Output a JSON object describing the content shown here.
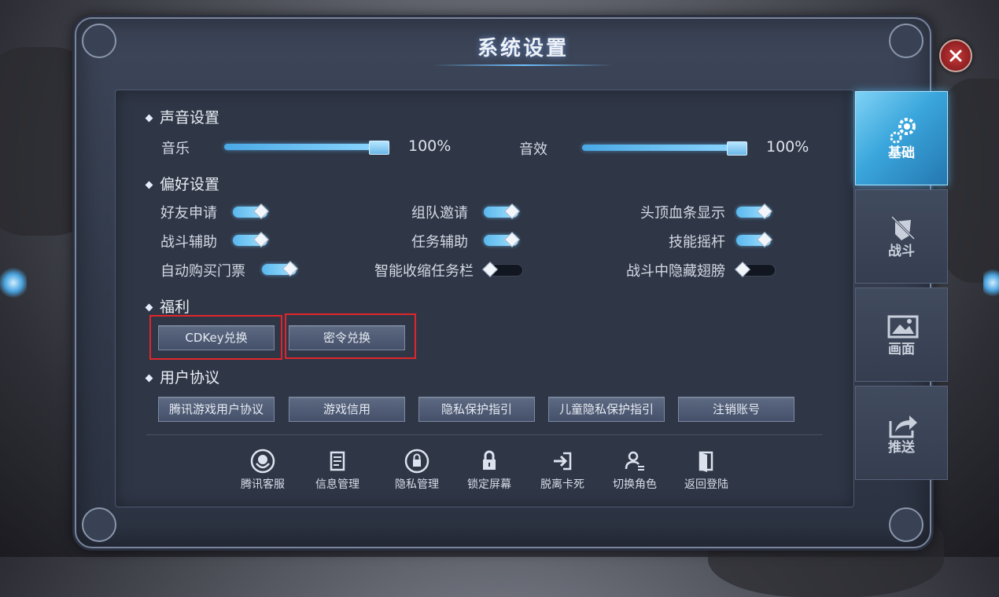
{
  "dialog": {
    "title": "系统设置"
  },
  "sound": {
    "section_title": "声音设置",
    "music_label": "音乐",
    "music_value": "100%",
    "effects_label": "音效",
    "effects_value": "100%"
  },
  "preferences": {
    "section_title": "偏好设置",
    "items": [
      {
        "label": "好友申请",
        "on": true
      },
      {
        "label": "组队邀请",
        "on": true
      },
      {
        "label": "头顶血条显示",
        "on": true
      },
      {
        "label": "战斗辅助",
        "on": true
      },
      {
        "label": "任务辅助",
        "on": true
      },
      {
        "label": "技能摇杆",
        "on": true
      },
      {
        "label": "自动购买门票",
        "on": true
      },
      {
        "label": "智能收缩任务栏",
        "on": false
      },
      {
        "label": "战斗中隐藏翅膀",
        "on": false
      }
    ]
  },
  "welfare": {
    "section_title": "福利",
    "cdkey_button": "CDKey兑换",
    "password_button": "密令兑换"
  },
  "agreement": {
    "section_title": "用户协议",
    "buttons": [
      "腾讯游戏用户协议",
      "游戏信用",
      "隐私保护指引",
      "儿童隐私保护指引",
      "注销账号"
    ]
  },
  "bottom_actions": [
    {
      "label": "腾讯客服",
      "icon": "customer-service-icon"
    },
    {
      "label": "信息管理",
      "icon": "document-icon"
    },
    {
      "label": "隐私管理",
      "icon": "privacy-lock-icon"
    },
    {
      "label": "锁定屏幕",
      "icon": "lock-icon"
    },
    {
      "label": "脱离卡死",
      "icon": "exit-arrow-icon"
    },
    {
      "label": "切换角色",
      "icon": "switch-user-icon"
    },
    {
      "label": "返回登陆",
      "icon": "door-icon"
    }
  ],
  "tabs": [
    {
      "label": "基础",
      "icon": "gear-icon",
      "active": true
    },
    {
      "label": "战斗",
      "icon": "sword-shield-icon",
      "active": false
    },
    {
      "label": "画面",
      "icon": "picture-icon",
      "active": false
    },
    {
      "label": "推送",
      "icon": "share-icon",
      "active": false
    }
  ],
  "colors": {
    "accent": "#4aa9e6",
    "highlight_box": "#e0262b",
    "close_button": "#b02c2f"
  }
}
